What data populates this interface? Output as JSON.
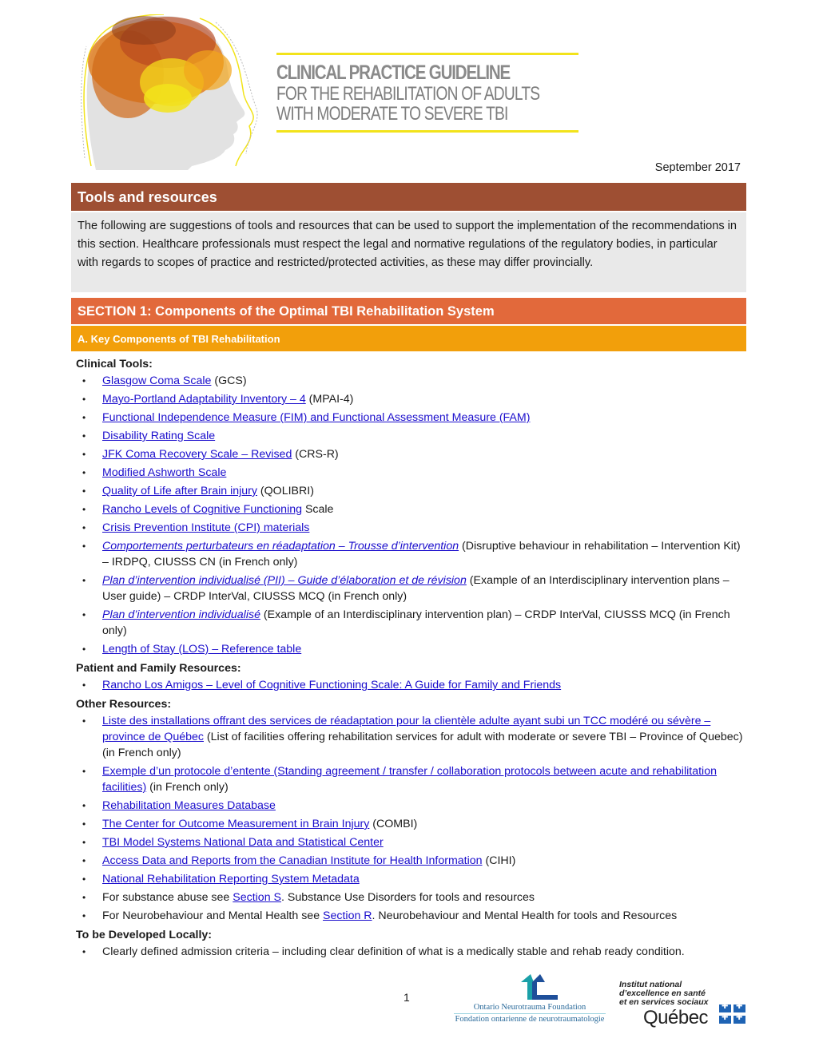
{
  "header": {
    "title_line1": "CLINICAL PRACTICE GUIDELINE",
    "title_line2": "FOR THE REHABILITATION OF ADULTS",
    "title_line3": "WITH MODERATE TO SEVERE TBI",
    "colors": {
      "accent_yellow": "#f2e31b",
      "title_gray": "#8a8a8a"
    }
  },
  "date": "September 2017",
  "tools_bar": {
    "title": "Tools and resources",
    "color": "#9e4f33"
  },
  "intro": "The following are suggestions of tools and resources that can be used to support the implementation of the recommendations in this section. Healthcare professionals must respect the legal and normative regulations of the regulatory bodies, in particular with regards to scopes of practice and restricted/protected activities, as these may differ provincially.",
  "section": {
    "title": "SECTION 1: Components of the Optimal TBI Rehabilitation System",
    "color": "#e2693b"
  },
  "subsection": {
    "title": "A. Key Components of TBI Rehabilitation",
    "color": "#f29f0b"
  },
  "groups": {
    "clinical": {
      "label": "Clinical Tools:",
      "items": [
        {
          "link": "Glasgow Coma Scale",
          "after": " (GCS)"
        },
        {
          "link": "Mayo-Portland Adaptability Inventory – 4",
          "after": " (MPAI-4)"
        },
        {
          "link": "Functional Independence Measure (FIM) and Functional Assessment Measure (FAM)",
          "after": ""
        },
        {
          "link": "Disability Rating Scale",
          "after": ""
        },
        {
          "link": "JFK Coma Recovery Scale – Revised",
          "after": " (CRS-R)"
        },
        {
          "link": "Modified Ashworth Scale",
          "after": ""
        },
        {
          "link": "Quality of Life after Brain injury",
          "after": " (QOLIBRI)"
        },
        {
          "link": "Rancho Levels of Cognitive Functioning",
          "after": " Scale"
        },
        {
          "link": "Crisis Prevention Institute (CPI) materials",
          "after": ""
        },
        {
          "link": "Comportements perturbateurs en réadaptation – Trousse d’intervention",
          "after": " (Disruptive behaviour in rehabilitation – Intervention Kit) – IRDPQ, CIUSSS CN (in French only)"
        },
        {
          "link": "Plan d’intervention individualisé (PII) – Guide d’élaboration et de révision",
          "after": " (Example of an Interdisciplinary intervention plans – User guide) – CRDP InterVal, CIUSSS MCQ (in French only)"
        },
        {
          "link": "Plan d’intervention individualisé",
          "after": " (Example of an Interdisciplinary intervention plan) – CRDP InterVal, CIUSSS MCQ (in French only)"
        },
        {
          "link": "Length of Stay (LOS) – Reference table",
          "after": ""
        }
      ]
    },
    "patient": {
      "label": "Patient and Family Resources:",
      "items": [
        {
          "link": "Rancho Los Amigos – Level of Cognitive Functioning Scale: A Guide for Family and Friends",
          "after": ""
        }
      ]
    },
    "other": {
      "label": "Other Resources:",
      "items": [
        {
          "link": "Liste des installations offrant des services de réadaptation pour la clientèle adulte ayant subi un TCC modéré ou sévère – province de Québec",
          "after": " (List of facilities offering rehabilitation services for adult with moderate or severe TBI – Province of Quebec) (in French only)"
        },
        {
          "link": "Exemple d’un protocole d’entente (Standing agreement / transfer / collaboration protocols between acute and rehabilitation facilities)",
          "after": " (in French only)"
        },
        {
          "link": "Rehabilitation Measures Database",
          "after": ""
        },
        {
          "link": "The Center for Outcome Measurement in Brain Injury",
          "after": " (COMBI)"
        },
        {
          "link": "TBI Model Systems National Data and Statistical Center",
          "after": ""
        },
        {
          "link": "Access Data and Reports from the Canadian Institute for Health Information",
          "after": " (CIHI)"
        },
        {
          "link": "National Rehabilitation Reporting System Metadata",
          "after": ""
        },
        {
          "before": "For substance abuse see ",
          "link": "Section S",
          "after": ". Substance Use Disorders for tools and resources"
        },
        {
          "before": "For Neurobehaviour and Mental Health see ",
          "link": "Section R",
          "after": ". Neurobehaviour and Mental Health for tools and Resources"
        }
      ]
    },
    "local": {
      "label": "To be Developed Locally:",
      "items": [
        {
          "text": "Clearly defined admission criteria – including clear definition of what is a medically stable and rehab ready condition."
        }
      ]
    }
  },
  "footer": {
    "page_number": "1",
    "onf_name_en": "Ontario Neurotrauma Foundation",
    "onf_name_fr": "Fondation ontarienne de neurotraumatologie",
    "inesss_line1": "Institut national",
    "inesss_line2": "d’excellence en santé",
    "inesss_line3": "et en services sociaux",
    "quebec": "Québec"
  },
  "link_color": "#1a0dcc"
}
